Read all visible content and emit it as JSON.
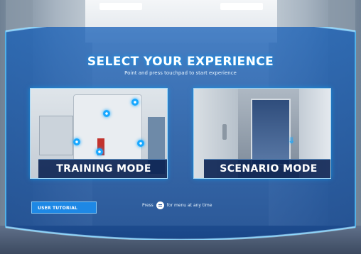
{
  "header": {
    "title": "SELECT YOUR EXPERIENCE",
    "subtitle": "Point and press touchpad to start experience"
  },
  "modes": [
    {
      "label": "TRAINING MODE"
    },
    {
      "label": "SCENARIO MODE"
    }
  ],
  "footer": {
    "tutorial_label": "USER TUTORIAL",
    "hint_prefix": "Press",
    "hint_icon": "menu-button-icon",
    "hint_suffix": "for menu at any time"
  },
  "colors": {
    "panel_glow": "#19a8ff",
    "panel_fill": "#0a3f8c",
    "label_bg": "#061e4e",
    "tutorial_bg": "#1e88e5"
  }
}
